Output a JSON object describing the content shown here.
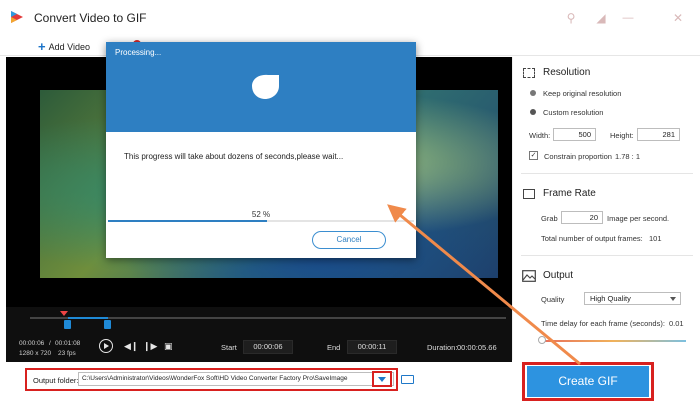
{
  "window": {
    "title": "Convert Video to GIF"
  },
  "toolbar": {
    "add_video_label": "Add Video",
    "add_icon": "plus-icon"
  },
  "dialog": {
    "title": "Processing...",
    "message": "This progress will take about dozens of seconds,please wait...",
    "progress_label": "52 %",
    "progress_value": 0.52,
    "cancel_label": "Cancel"
  },
  "player": {
    "current_time": "00:00:06",
    "total_time": "00:01:08",
    "separator": "/",
    "resolution": "1280 x 720",
    "fps": "23 fps",
    "start_label": "Start",
    "start_value": "00:00:06",
    "end_label": "End",
    "end_value": "00:00:11",
    "duration_label": "Duration:",
    "duration_value": "00:00:05.66"
  },
  "resolution": {
    "title": "Resolution",
    "keep_original": "Keep original resolution",
    "custom": "Custom resolution",
    "width_label": "Width:",
    "width_value": "500",
    "height_label": "Height:",
    "height_value": "281",
    "constrain_label": "Constrain proportion",
    "proportion_value": "1.78 : 1"
  },
  "frame_rate": {
    "title": "Frame Rate",
    "grab_label": "Grab",
    "grab_value": "20",
    "per_second_label": "Image per second.",
    "total_label": "Total number of output frames:",
    "total_value": "101"
  },
  "output": {
    "title": "Output",
    "quality_label": "Quality",
    "quality_value": "High Quality",
    "delay_label": "Time delay for each frame (seconds):",
    "delay_value": "0.01"
  },
  "bottom": {
    "output_folder_label": "Output folder:",
    "output_path": "C:\\Users\\Administrator\\Videos\\WonderFox Soft\\HD Video Converter Factory Pro\\SaveImage",
    "create_gif_label": "Create GIF"
  },
  "colors": {
    "accent": "#2e7fc2",
    "highlight": "#d8211f",
    "create_button": "#2d93e0",
    "arrow": "#f08a4b"
  }
}
